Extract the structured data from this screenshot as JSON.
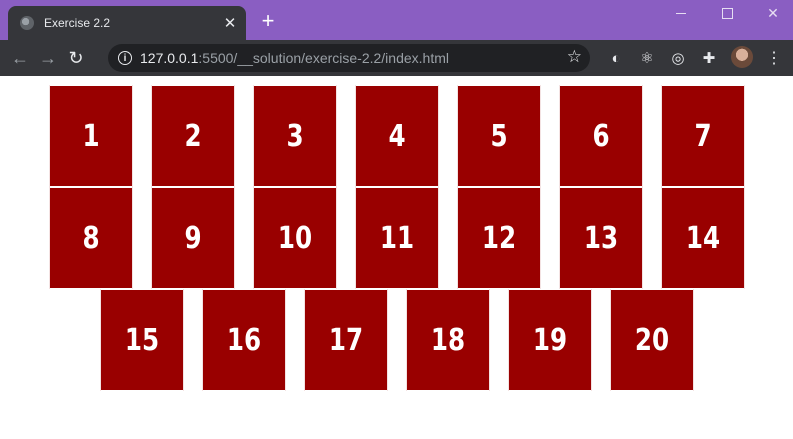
{
  "browser": {
    "tab_title": "Exercise 2.2",
    "url_host": "127.0.0.1",
    "url_path": ":5500/__solution/exercise-2.2/index.html"
  },
  "page": {
    "boxes": [
      "1",
      "2",
      "3",
      "4",
      "5",
      "6",
      "7",
      "8",
      "9",
      "10",
      "11",
      "12",
      "13",
      "14",
      "15",
      "16",
      "17",
      "18",
      "19",
      "20"
    ],
    "box_color": "#990000"
  }
}
